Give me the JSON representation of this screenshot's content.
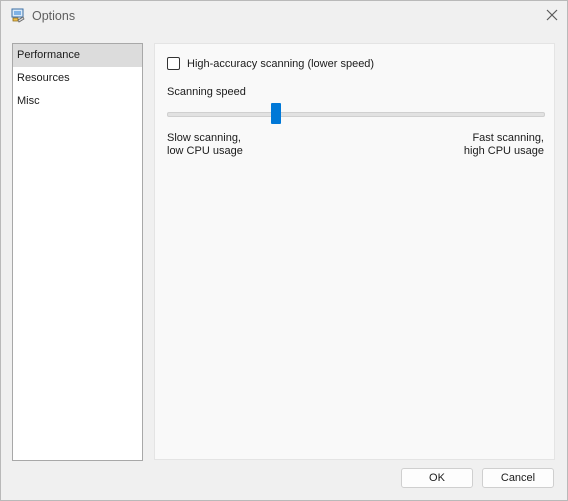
{
  "window": {
    "title": "Options"
  },
  "nav": {
    "items": [
      "Performance",
      "Resources",
      "Misc"
    ],
    "selected": "Performance"
  },
  "performance": {
    "high_accuracy_label": "High-accuracy scanning (lower speed)",
    "high_accuracy_checked": false,
    "scanning_speed_label": "Scanning speed",
    "slider_value_fraction": 0.29,
    "slow_label_line1": "Slow scanning,",
    "slow_label_line2": "low CPU usage",
    "fast_label_line1": "Fast scanning,",
    "fast_label_line2": "high CPU usage"
  },
  "buttons": {
    "ok": "OK",
    "cancel": "Cancel"
  },
  "colors": {
    "accent": "#0078d7"
  },
  "icons": {
    "app": "options-app-icon",
    "close": "close-icon"
  }
}
